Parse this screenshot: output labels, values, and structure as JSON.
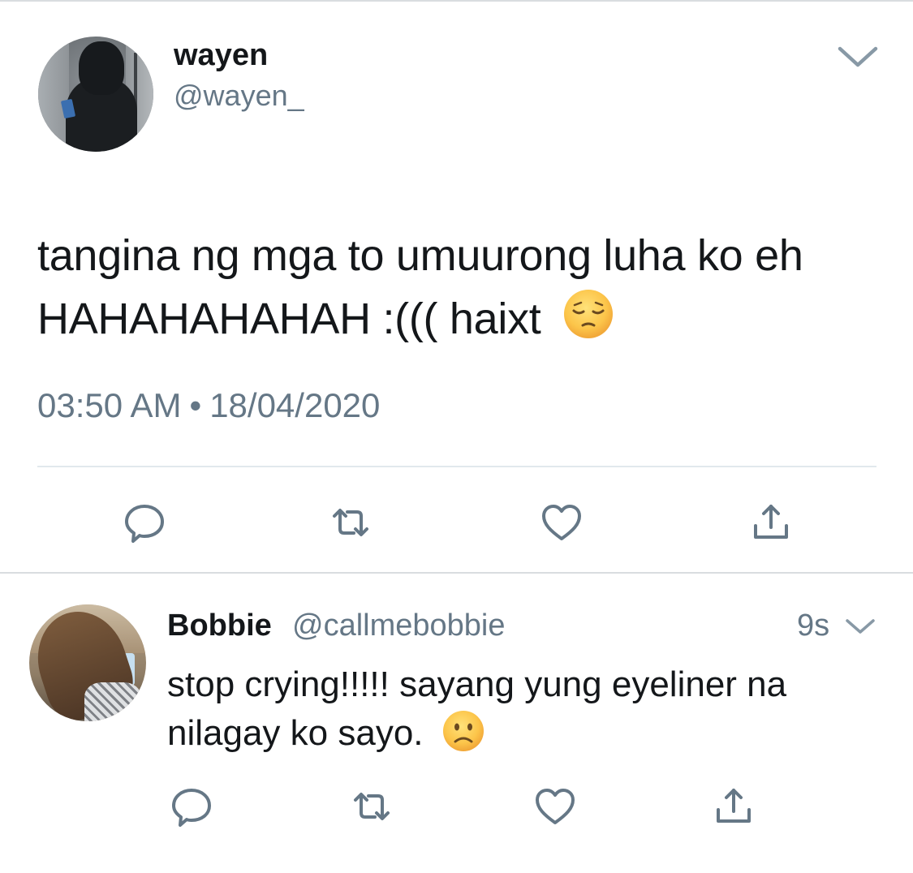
{
  "tweet": {
    "author": {
      "name": "wayen",
      "handle": "@wayen_"
    },
    "text": "tangina ng mga to umuurong luha ko eh HAHAHAHAHAH :((( haixt",
    "emoji": "pensive-face",
    "time": "03:50 AM",
    "separator": "•",
    "date": "18/04/2020",
    "actions": [
      "reply-icon",
      "retweet-icon",
      "like-icon",
      "share-icon"
    ]
  },
  "reply": {
    "author": {
      "name": "Bobbie",
      "handle": "@callmebobbie"
    },
    "relative_time": "9s",
    "text": "stop crying!!!!! sayang yung eyeliner na nilagay ko sayo.",
    "emoji": "frowning-face",
    "actions": [
      "reply-icon",
      "retweet-icon",
      "like-icon",
      "share-icon"
    ]
  },
  "colors": {
    "text_primary": "#14171a",
    "text_secondary": "#657786",
    "icon": "#657786",
    "divider": "#e1e8ed",
    "emoji_yellow": "#fcc54a"
  }
}
